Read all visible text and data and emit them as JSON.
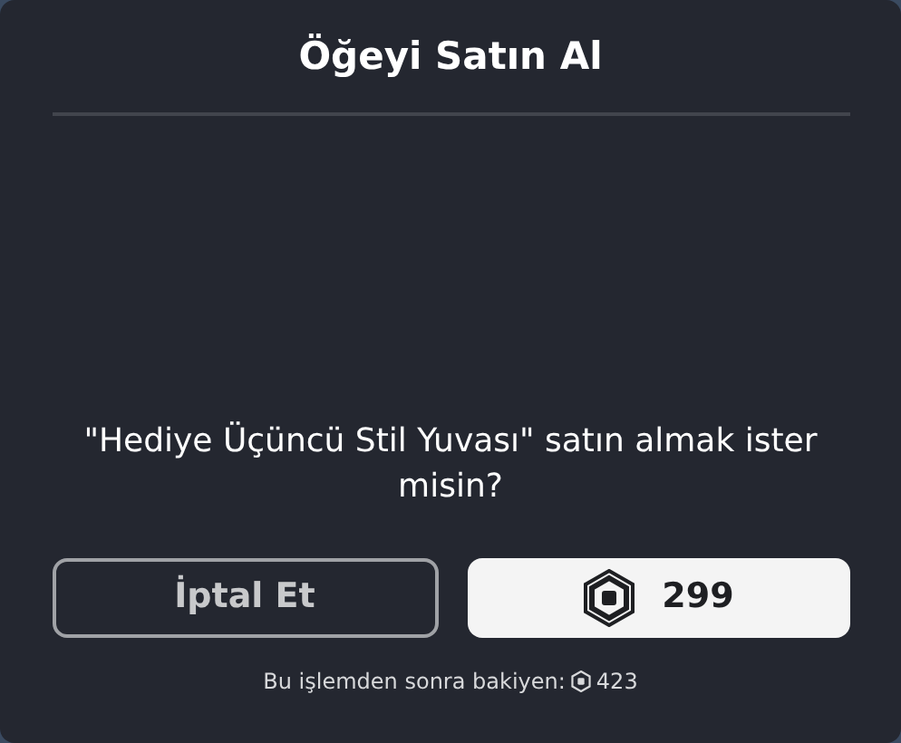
{
  "dialog": {
    "title": "Öğeyi Satın Al",
    "message": "\"Hediye Üçüncü Stil Yuvası\" satın almak ister misin?",
    "cancel_button": "İptal Et",
    "buy_button": {
      "price": "299"
    },
    "balance_note": {
      "label": "Bu işlemden sonra bakiyen:",
      "amount": "423"
    }
  }
}
